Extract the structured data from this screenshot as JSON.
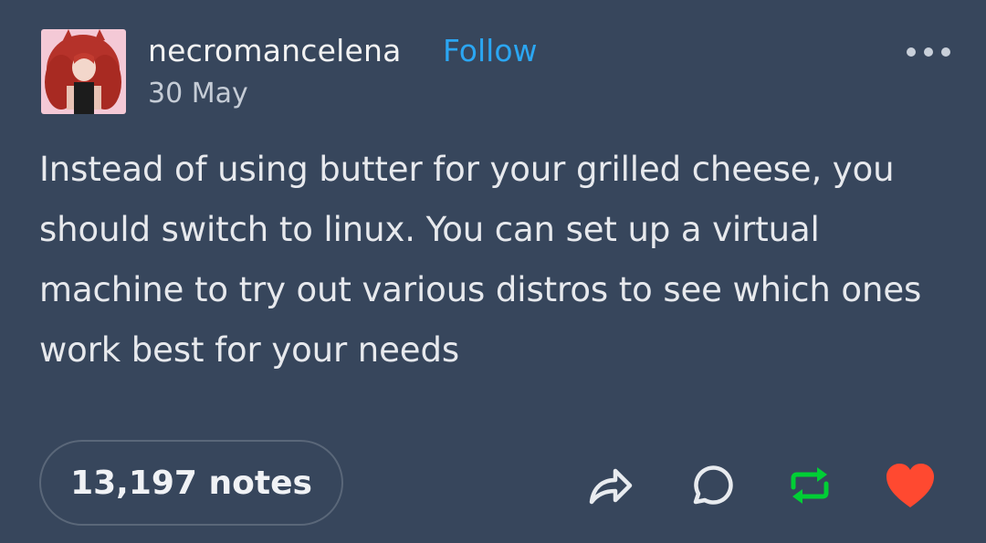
{
  "post": {
    "username": "necromancelena",
    "follow_label": "Follow",
    "date": "30 May",
    "body": "Instead of using butter for your grilled cheese, you should switch to linux. You can set up a virtual machine to try out various distros to see which ones work best for your needs",
    "notes_label": "13,197 notes"
  },
  "icons": {
    "more": "ellipsis-icon",
    "share": "share-icon",
    "reply": "reply-icon",
    "reblog": "reblog-icon",
    "like": "heart-icon"
  },
  "colors": {
    "background": "#37465c",
    "follow": "#2ba6f2",
    "reblog": "#00cf35",
    "like": "#ff4930"
  }
}
